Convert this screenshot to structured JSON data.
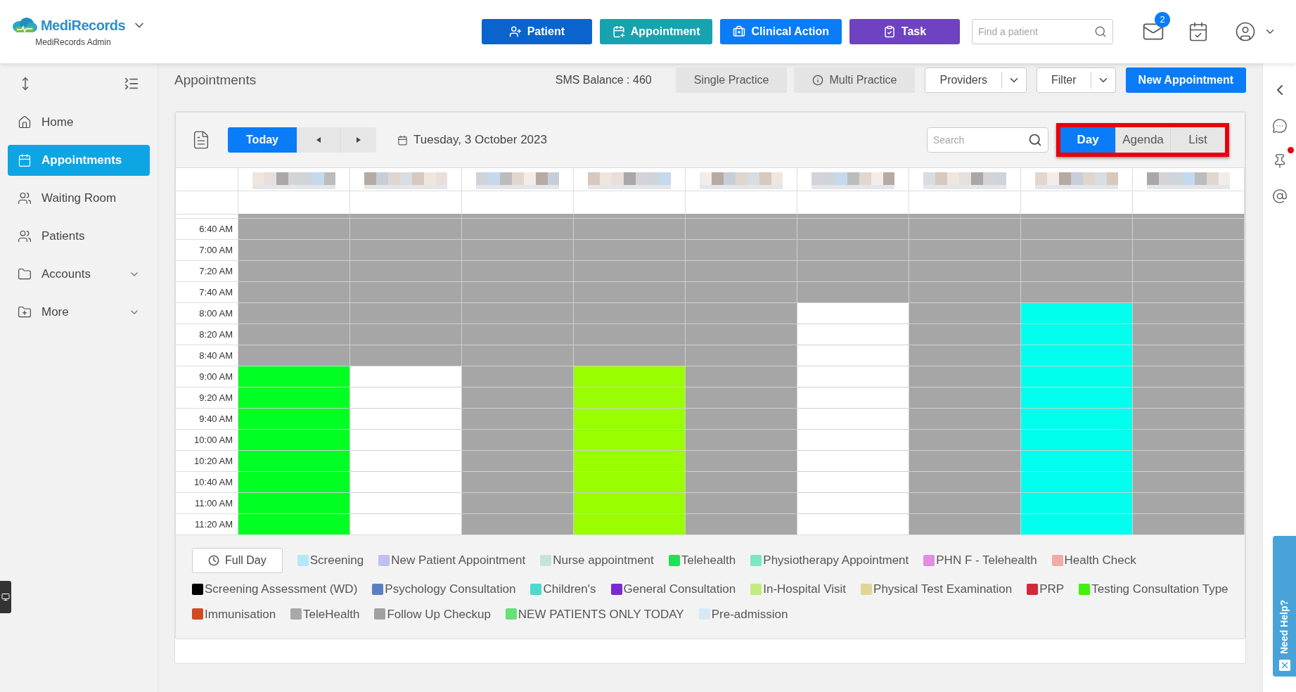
{
  "header": {
    "brand": "MediRecords",
    "subtitle": "MediRecords Admin",
    "actions": [
      {
        "kind": "patient",
        "label": "Patient",
        "color": "#0b63ce"
      },
      {
        "kind": "appointment",
        "label": "Appointment",
        "color": "#17a2b0"
      },
      {
        "kind": "clinical",
        "label": "Clinical Action",
        "color": "#0a7cf7"
      },
      {
        "kind": "task",
        "label": "Task",
        "color": "#6f42c1"
      }
    ],
    "search": {
      "placeholder": "Find a patient"
    },
    "mail_badge": "2"
  },
  "sidebar": {
    "items": [
      {
        "kind": "home",
        "label": "Home",
        "selected": false,
        "submenu": false
      },
      {
        "kind": "calendar",
        "label": "Appointments",
        "selected": true,
        "submenu": false
      },
      {
        "kind": "waiting",
        "label": "Waiting Room",
        "selected": false,
        "submenu": false
      },
      {
        "kind": "patients",
        "label": "Patients",
        "selected": false,
        "submenu": false
      },
      {
        "kind": "folder",
        "label": "Accounts",
        "selected": false,
        "submenu": true
      },
      {
        "kind": "folder-plus",
        "label": "More",
        "selected": false,
        "submenu": true
      }
    ]
  },
  "page": {
    "title": "Appointments",
    "sms_balance": "SMS Balance : 460",
    "practice_tabs": [
      {
        "label": "Single Practice",
        "info": false
      },
      {
        "label": "Multi Practice",
        "info": true
      }
    ],
    "dropdowns": [
      "Providers",
      "Filter"
    ],
    "primary_button": "New Appointment"
  },
  "calendar": {
    "today": "Today",
    "date": "Tuesday, 3 October 2023",
    "search": {
      "placeholder": "Search"
    },
    "views": [
      {
        "label": "Day",
        "selected": true
      },
      {
        "label": "Agenda",
        "selected": false
      },
      {
        "label": "List",
        "selected": false
      }
    ],
    "views_highlighted": true,
    "times": [
      "6:40 AM",
      "7:00 AM",
      "7:20 AM",
      "7:40 AM",
      "8:00 AM",
      "8:20 AM",
      "8:40 AM",
      "9:00 AM",
      "9:20 AM",
      "9:40 AM",
      "10:00 AM",
      "10:20 AM",
      "10:40 AM",
      "11:00 AM",
      "11:20 AM"
    ],
    "columns": [
      {
        "slots": [
          {
            "color": "#a6a6a6"
          },
          {
            "color": "#a6a6a6"
          },
          {
            "color": "#a6a6a6"
          },
          {
            "color": "#a6a6a6"
          },
          {
            "color": "#a6a6a6"
          },
          {
            "color": "#a6a6a6"
          },
          {
            "color": "#a6a6a6"
          },
          {
            "color": "#00ff22"
          },
          {
            "color": "#00ff22"
          },
          {
            "color": "#00ff22"
          },
          {
            "color": "#00ff22"
          },
          {
            "color": "#00ff22"
          },
          {
            "color": "#00ff22"
          },
          {
            "color": "#00ff22"
          },
          {
            "color": "#00ff22"
          }
        ]
      },
      {
        "slots": [
          {
            "color": "#a6a6a6"
          },
          {
            "color": "#a6a6a6"
          },
          {
            "color": "#a6a6a6"
          },
          {
            "color": "#a6a6a6"
          },
          {
            "color": "#a6a6a6"
          },
          {
            "color": "#a6a6a6"
          },
          {
            "color": "#a6a6a6"
          },
          {
            "color": "#ffffff"
          },
          {
            "color": "#ffffff"
          },
          {
            "color": "#ffffff"
          },
          {
            "color": "#ffffff"
          },
          {
            "color": "#ffffff"
          },
          {
            "color": "#ffffff"
          },
          {
            "color": "#ffffff"
          },
          {
            "color": "#ffffff"
          }
        ]
      },
      {
        "slots": [
          {
            "color": "#a6a6a6"
          },
          {
            "color": "#a6a6a6"
          },
          {
            "color": "#a6a6a6"
          },
          {
            "color": "#a6a6a6"
          },
          {
            "color": "#a6a6a6"
          },
          {
            "color": "#a6a6a6"
          },
          {
            "color": "#a6a6a6"
          },
          {
            "color": "#a6a6a6"
          },
          {
            "color": "#a6a6a6"
          },
          {
            "color": "#a6a6a6"
          },
          {
            "color": "#a6a6a6"
          },
          {
            "color": "#a6a6a6"
          },
          {
            "color": "#a6a6a6"
          },
          {
            "color": "#a6a6a6"
          },
          {
            "color": "#a6a6a6"
          }
        ]
      },
      {
        "slots": [
          {
            "color": "#a6a6a6"
          },
          {
            "color": "#a6a6a6"
          },
          {
            "color": "#a6a6a6"
          },
          {
            "color": "#a6a6a6"
          },
          {
            "color": "#a6a6a6"
          },
          {
            "color": "#a6a6a6"
          },
          {
            "color": "#a6a6a6"
          },
          {
            "color": "#99ff00"
          },
          {
            "color": "#99ff00"
          },
          {
            "color": "#99ff00"
          },
          {
            "color": "#99ff00"
          },
          {
            "color": "#99ff00"
          },
          {
            "color": "#99ff00"
          },
          {
            "color": "#99ff00"
          },
          {
            "color": "#99ff00"
          }
        ]
      },
      {
        "slots": [
          {
            "color": "#a6a6a6"
          },
          {
            "color": "#a6a6a6"
          },
          {
            "color": "#a6a6a6"
          },
          {
            "color": "#a6a6a6"
          },
          {
            "color": "#a6a6a6"
          },
          {
            "color": "#a6a6a6"
          },
          {
            "color": "#a6a6a6"
          },
          {
            "color": "#a6a6a6"
          },
          {
            "color": "#a6a6a6"
          },
          {
            "color": "#a6a6a6"
          },
          {
            "color": "#a6a6a6"
          },
          {
            "color": "#a6a6a6"
          },
          {
            "color": "#a6a6a6"
          },
          {
            "color": "#a6a6a6"
          },
          {
            "color": "#a6a6a6"
          }
        ]
      },
      {
        "slots": [
          {
            "color": "#a6a6a6"
          },
          {
            "color": "#a6a6a6"
          },
          {
            "color": "#a6a6a6"
          },
          {
            "color": "#a6a6a6"
          },
          {
            "color": "#ffffff"
          },
          {
            "color": "#ffffff"
          },
          {
            "color": "#ffffff"
          },
          {
            "color": "#ffffff"
          },
          {
            "color": "#ffffff"
          },
          {
            "color": "#ffffff"
          },
          {
            "color": "#ffffff"
          },
          {
            "color": "#ffffff"
          },
          {
            "color": "#ffffff"
          },
          {
            "color": "#ffffff"
          },
          {
            "color": "#ffffff"
          }
        ]
      },
      {
        "slots": [
          {
            "color": "#a6a6a6"
          },
          {
            "color": "#a6a6a6"
          },
          {
            "color": "#a6a6a6"
          },
          {
            "color": "#a6a6a6"
          },
          {
            "color": "#a6a6a6"
          },
          {
            "color": "#a6a6a6"
          },
          {
            "color": "#a6a6a6"
          },
          {
            "color": "#a6a6a6"
          },
          {
            "color": "#a6a6a6"
          },
          {
            "color": "#a6a6a6"
          },
          {
            "color": "#a6a6a6"
          },
          {
            "color": "#a6a6a6"
          },
          {
            "color": "#a6a6a6"
          },
          {
            "color": "#a6a6a6"
          },
          {
            "color": "#a6a6a6"
          }
        ]
      },
      {
        "slots": [
          {
            "color": "#a6a6a6"
          },
          {
            "color": "#a6a6a6"
          },
          {
            "color": "#a6a6a6"
          },
          {
            "color": "#a6a6a6"
          },
          {
            "color": "#00ffee"
          },
          {
            "color": "#00ffee"
          },
          {
            "color": "#00ffee"
          },
          {
            "color": "#00ffee"
          },
          {
            "color": "#00ffee"
          },
          {
            "color": "#00ffee"
          },
          {
            "color": "#00ffee"
          },
          {
            "color": "#00ffee"
          },
          {
            "color": "#00ffee"
          },
          {
            "color": "#00ffee"
          },
          {
            "color": "#00ffee"
          }
        ]
      },
      {
        "slots": [
          {
            "color": "#a6a6a6"
          },
          {
            "color": "#a6a6a6"
          },
          {
            "color": "#a6a6a6"
          },
          {
            "color": "#a6a6a6"
          },
          {
            "color": "#a6a6a6"
          },
          {
            "color": "#a6a6a6"
          },
          {
            "color": "#a6a6a6"
          },
          {
            "color": "#a6a6a6"
          },
          {
            "color": "#a6a6a6"
          },
          {
            "color": "#a6a6a6"
          },
          {
            "color": "#a6a6a6"
          },
          {
            "color": "#a6a6a6"
          },
          {
            "color": "#a6a6a6"
          },
          {
            "color": "#a6a6a6"
          },
          {
            "color": "#a6a6a6"
          }
        ]
      }
    ],
    "full_day": "Full Day",
    "legend": [
      {
        "label": "Screening",
        "color": "#b3e8f7"
      },
      {
        "label": "New Patient Appointment",
        "color": "#c0c0f0"
      },
      {
        "label": "Nurse appointment",
        "color": "#c5e3dc"
      },
      {
        "label": "Telehealth",
        "color": "#22e055"
      },
      {
        "label": "Physiotherapy Appointment",
        "color": "#7be8c0"
      },
      {
        "label": "PHN F - Telehealth",
        "color": "#e08ee0"
      },
      {
        "label": "Health Check",
        "color": "#f2aaa8"
      },
      {
        "label": "Screening Assessment (WD)",
        "color": "#000000"
      },
      {
        "label": "Psychology Consultation",
        "color": "#5b7fc4"
      },
      {
        "label": "Children's",
        "color": "#4dd9cc"
      },
      {
        "label": "General Consultation",
        "color": "#7a2ad4"
      },
      {
        "label": "In-Hospital Visit",
        "color": "#c0ec7c"
      },
      {
        "label": "Physical Test Examination",
        "color": "#e2d498"
      },
      {
        "label": "PRP",
        "color": "#d02a3a"
      },
      {
        "label": "Testing Consultation Type",
        "color": "#44ee11"
      },
      {
        "label": "Immunisation",
        "color": "#d04a22"
      },
      {
        "label": "TeleHealth",
        "color": "#a8a8a8"
      },
      {
        "label": "Follow Up Checkup",
        "color": "#a0a0a0"
      },
      {
        "label": "NEW PATIENTS ONLY TODAY",
        "color": "#66e07a"
      },
      {
        "label": "Pre-admission",
        "color": "#d8e8f6"
      }
    ]
  },
  "right_rail": {
    "pin_alert": true
  },
  "help_tab": "Need Help?"
}
